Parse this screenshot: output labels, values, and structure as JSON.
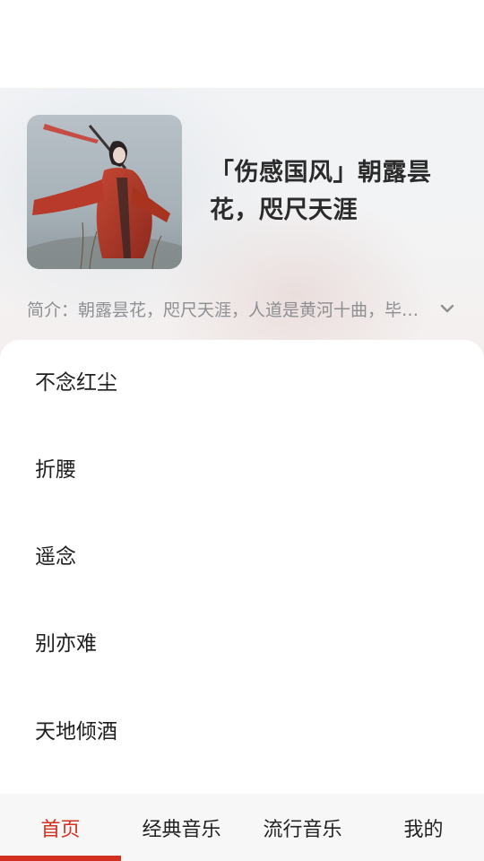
{
  "colors": {
    "accent": "#d4301f",
    "title_text": "#2b2b2b",
    "muted_text": "#8e8f93",
    "tab_bar_bg": "#f7f7f7"
  },
  "album": {
    "cover_icon": "album-cover-image",
    "title": "「伤感国风」朝露昙花，咫尺天涯",
    "intro": "简介：朝露昙花，咫尺天涯，人道是黄河十曲，毕…",
    "expand_icon": "chevron-down-icon"
  },
  "songs": [
    {
      "title": "不念红尘"
    },
    {
      "title": "折腰"
    },
    {
      "title": "遥念"
    },
    {
      "title": "别亦难"
    },
    {
      "title": "天地倾酒"
    }
  ],
  "tabs": [
    {
      "label": "首页",
      "active": true
    },
    {
      "label": "经典音乐",
      "active": false
    },
    {
      "label": "流行音乐",
      "active": false
    },
    {
      "label": "我的",
      "active": false
    }
  ]
}
